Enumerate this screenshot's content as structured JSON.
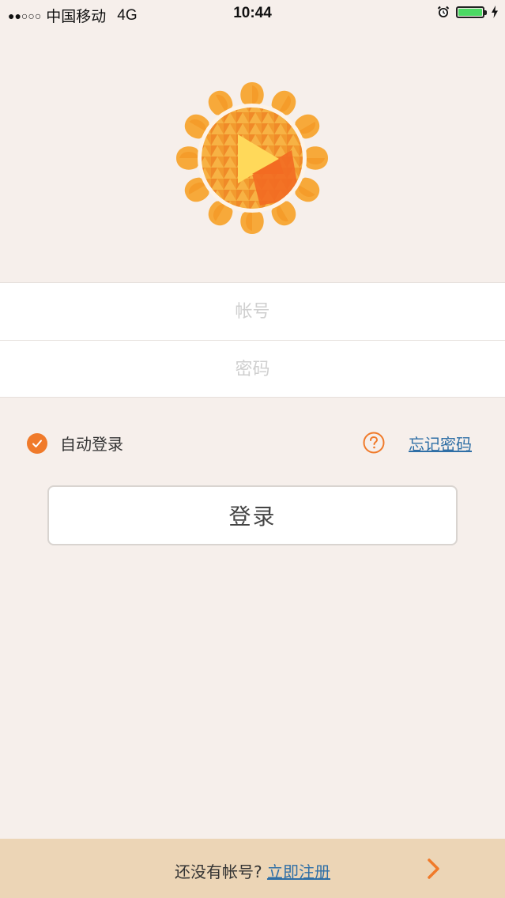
{
  "status_bar": {
    "signal_dots": "●●○○○",
    "carrier": "中国移动",
    "network": "4G",
    "time": "10:44",
    "battery_level": 1.0,
    "battery_color": "#4cd964",
    "icons": [
      "alarm-icon",
      "battery-icon",
      "charging-bolt-icon"
    ]
  },
  "logo": {
    "icon": "sunflower-play-logo",
    "colors": [
      "#f5a623",
      "#f07a2a",
      "#ffd95a"
    ]
  },
  "login_form": {
    "account_placeholder": "帐号",
    "password_placeholder": "密码",
    "account_value": "",
    "password_value": ""
  },
  "options": {
    "auto_login_label": "自动登录",
    "auto_login_checked": true,
    "help_icon": "question-circle-icon",
    "forgot_password_label": "忘记密码"
  },
  "login_button": {
    "label": "登录"
  },
  "bottom_bar": {
    "prompt": "还没有帐号?",
    "register_label": "立即注册",
    "arrow_icon": "chevron-right-icon"
  },
  "colors": {
    "accent": "#f07a2a",
    "link": "#2f6fa6",
    "background": "#f6efeb",
    "bottom_bar": "#ecd5b6"
  }
}
